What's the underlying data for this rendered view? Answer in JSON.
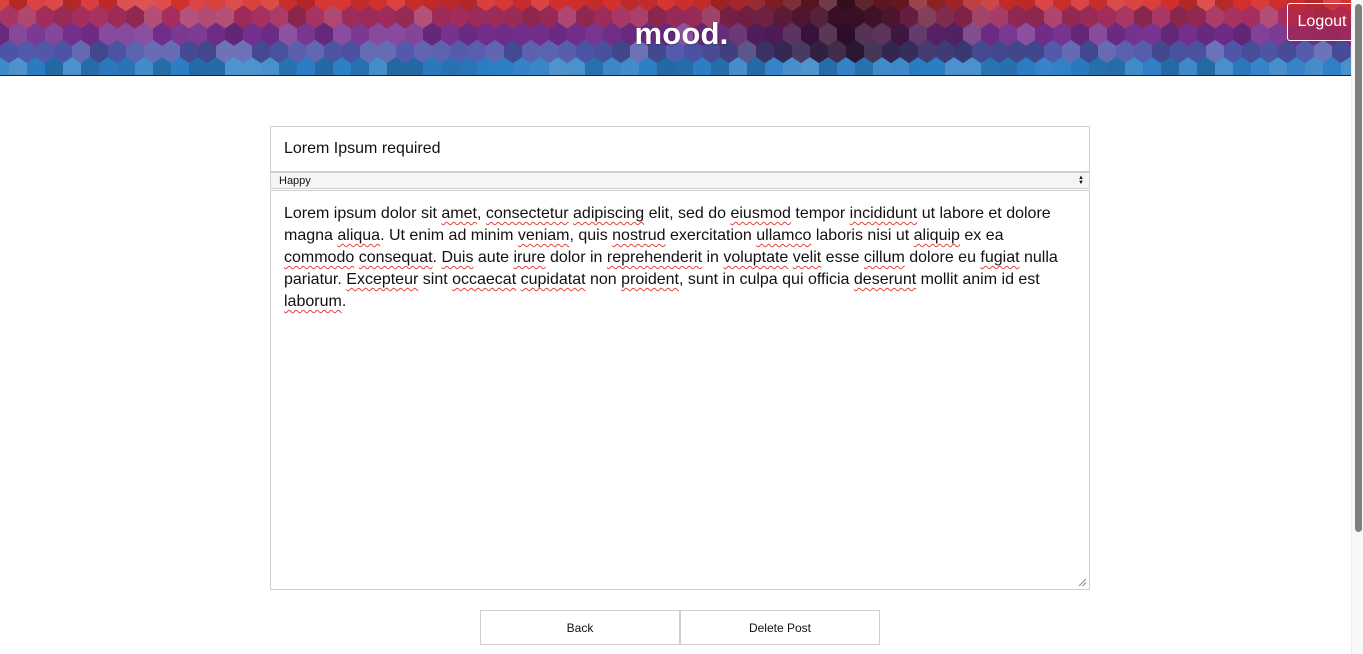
{
  "header": {
    "brand": "mood.",
    "logout_label": "Logout"
  },
  "post": {
    "title_value": "Lorem Ipsum required",
    "mood_selected": "Happy",
    "body_segments": [
      {
        "t": "Lorem ipsum dolor sit "
      },
      {
        "t": "amet",
        "s": true
      },
      {
        "t": ", "
      },
      {
        "t": "consectetur",
        "s": true
      },
      {
        "t": " "
      },
      {
        "t": "adipiscing",
        "s": true
      },
      {
        "t": " elit, sed do "
      },
      {
        "t": "eiusmod",
        "s": true
      },
      {
        "t": " tempor "
      },
      {
        "t": "incididunt",
        "s": true
      },
      {
        "t": " ut labore et dolore magna "
      },
      {
        "t": "aliqua",
        "s": true
      },
      {
        "t": ". Ut enim ad minim "
      },
      {
        "t": "veniam",
        "s": true
      },
      {
        "t": ", quis "
      },
      {
        "t": "nostrud",
        "s": true
      },
      {
        "t": " exercitation "
      },
      {
        "t": "ullamco",
        "s": true
      },
      {
        "t": " laboris nisi ut "
      },
      {
        "t": "aliquip",
        "s": true
      },
      {
        "t": " ex ea "
      },
      {
        "t": "commodo",
        "s": true
      },
      {
        "t": " "
      },
      {
        "t": "consequat",
        "s": true
      },
      {
        "t": ". "
      },
      {
        "t": "Duis",
        "s": true
      },
      {
        "t": " aute "
      },
      {
        "t": "irure",
        "s": true
      },
      {
        "t": " dolor in "
      },
      {
        "t": "reprehenderit",
        "s": true
      },
      {
        "t": " in "
      },
      {
        "t": "voluptate",
        "s": true
      },
      {
        "t": " "
      },
      {
        "t": "velit",
        "s": true
      },
      {
        "t": " esse "
      },
      {
        "t": "cillum",
        "s": true
      },
      {
        "t": " dolore eu "
      },
      {
        "t": "fugiat",
        "s": true
      },
      {
        "t": " nulla pariatur. "
      },
      {
        "t": "Excepteur",
        "s": true
      },
      {
        "t": " sint "
      },
      {
        "t": "occaecat",
        "s": true
      },
      {
        "t": " "
      },
      {
        "t": "cupidatat",
        "s": true
      },
      {
        "t": " non "
      },
      {
        "t": "proident",
        "s": true
      },
      {
        "t": ", sunt in culpa qui officia "
      },
      {
        "t": "deserunt",
        "s": true
      },
      {
        "t": " mollit anim id est "
      },
      {
        "t": "laborum",
        "s": true
      },
      {
        "t": "."
      }
    ]
  },
  "actions": {
    "back_label": "Back",
    "delete_label": "Delete Post"
  },
  "icons": {
    "select_arrow": "select-arrows-icon",
    "resize": "resize-grip-icon"
  },
  "colors": {
    "banner_red": "#d8322f",
    "banner_purple": "#6a2c86",
    "banner_blue": "#1f8fcf",
    "spellcheck": "#e0443c"
  }
}
